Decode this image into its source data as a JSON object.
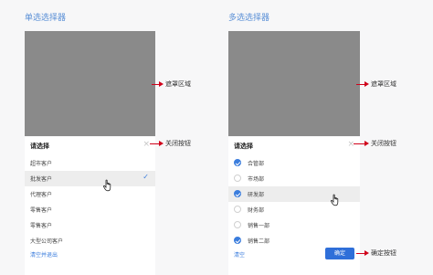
{
  "single": {
    "section_title": "单选选择器",
    "sheet_title": "请选择",
    "close_icon": "×",
    "options": [
      "超市客户",
      "批发客户",
      "代理客户",
      "零售客户",
      "零售客户",
      "大型公司客户"
    ],
    "selected_index": 1,
    "hover_index": 1,
    "check_icon": "✓",
    "footer_link": "清空并退出"
  },
  "multi": {
    "section_title": "多选选择器",
    "sheet_title": "请选择",
    "close_icon": "×",
    "options": [
      {
        "label": "合管部",
        "checked": true
      },
      {
        "label": "市场部",
        "checked": false
      },
      {
        "label": "研发部",
        "checked": true
      },
      {
        "label": "财务部",
        "checked": false
      },
      {
        "label": "销售一部",
        "checked": false
      },
      {
        "label": "销售二部",
        "checked": true
      }
    ],
    "hover_index": 2,
    "clear_link": "清空",
    "confirm_button": "确定"
  },
  "annotations": {
    "mask_area": "遮罩区域",
    "close_button": "关闭按钮",
    "confirm_button": "确定按钮"
  },
  "colors": {
    "accent": "#3b7ddd",
    "mask": "#8a8a8a",
    "arrow": "#d0021b",
    "title": "#5a8fd6"
  }
}
